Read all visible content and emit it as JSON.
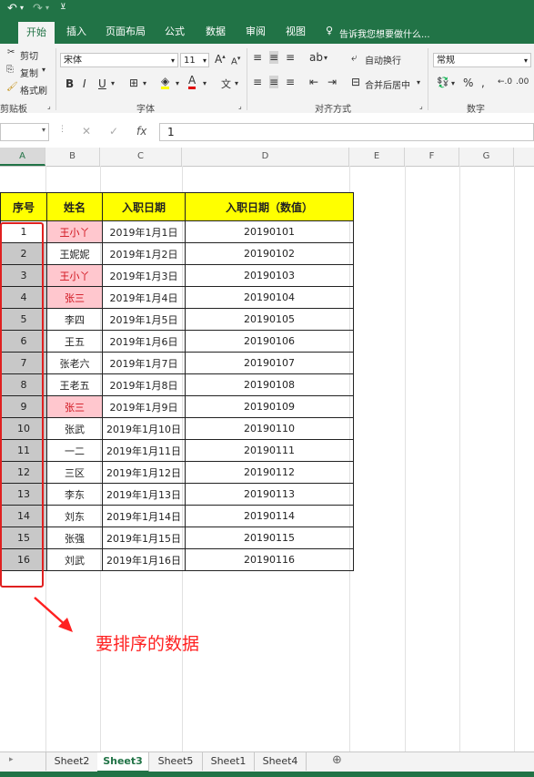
{
  "ribbon": {
    "tabs": [
      {
        "label": "开始",
        "active": true
      },
      {
        "label": "插入",
        "active": false
      },
      {
        "label": "页面布局",
        "active": false
      },
      {
        "label": "公式",
        "active": false
      },
      {
        "label": "数据",
        "active": false
      },
      {
        "label": "审阅",
        "active": false
      },
      {
        "label": "视图",
        "active": false
      }
    ],
    "tell_me": "告诉我您想要做什么...",
    "clipboard": {
      "cut": "剪切",
      "copy": "复制",
      "format_painter": "格式刷",
      "group": "剪贴板"
    },
    "font": {
      "name": "宋体",
      "size": "11",
      "group": "字体"
    },
    "alignment": {
      "wrap": "自动换行",
      "merge": "合并后居中",
      "group": "对齐方式"
    },
    "number": {
      "format": "常规",
      "group": "数字"
    }
  },
  "formula_bar": {
    "name_box": "",
    "formula": "1",
    "fx": "fx"
  },
  "columns": [
    "A",
    "B",
    "C",
    "D",
    "E",
    "F",
    "G"
  ],
  "table": {
    "headers": [
      "序号",
      "姓名",
      "入职日期",
      "入职日期（数值）"
    ],
    "rows": [
      {
        "seq": "1",
        "name": "王小丫",
        "date": "2019年1月1日",
        "num": "20190101",
        "dup": true
      },
      {
        "seq": "2",
        "name": "王妮妮",
        "date": "2019年1月2日",
        "num": "20190102",
        "dup": false
      },
      {
        "seq": "3",
        "name": "王小丫",
        "date": "2019年1月3日",
        "num": "20190103",
        "dup": true
      },
      {
        "seq": "4",
        "name": "张三",
        "date": "2019年1月4日",
        "num": "20190104",
        "dup": true
      },
      {
        "seq": "5",
        "name": "李四",
        "date": "2019年1月5日",
        "num": "20190105",
        "dup": false
      },
      {
        "seq": "6",
        "name": "王五",
        "date": "2019年1月6日",
        "num": "20190106",
        "dup": false
      },
      {
        "seq": "7",
        "name": "张老六",
        "date": "2019年1月7日",
        "num": "20190107",
        "dup": false
      },
      {
        "seq": "8",
        "name": "王老五",
        "date": "2019年1月8日",
        "num": "20190108",
        "dup": false
      },
      {
        "seq": "9",
        "name": "张三",
        "date": "2019年1月9日",
        "num": "20190109",
        "dup": true
      },
      {
        "seq": "10",
        "name": "张武",
        "date": "2019年1月10日",
        "num": "20190110",
        "dup": false
      },
      {
        "seq": "11",
        "name": "一二",
        "date": "2019年1月11日",
        "num": "20190111",
        "dup": false
      },
      {
        "seq": "12",
        "name": "三区",
        "date": "2019年1月12日",
        "num": "20190112",
        "dup": false
      },
      {
        "seq": "13",
        "name": "李东",
        "date": "2019年1月13日",
        "num": "20190113",
        "dup": false
      },
      {
        "seq": "14",
        "name": "刘东",
        "date": "2019年1月14日",
        "num": "20190114",
        "dup": false
      },
      {
        "seq": "15",
        "name": "张强",
        "date": "2019年1月15日",
        "num": "20190115",
        "dup": false
      },
      {
        "seq": "16",
        "name": "刘武",
        "date": "2019年1月16日",
        "num": "20190116",
        "dup": false
      }
    ]
  },
  "annotation": "要排序的数据",
  "sheets": [
    {
      "label": "Sheet2",
      "active": false
    },
    {
      "label": "Sheet3",
      "active": true
    },
    {
      "label": "Sheet5",
      "active": false
    },
    {
      "label": "Sheet1",
      "active": false
    },
    {
      "label": "Sheet4",
      "active": false
    }
  ],
  "colors": {
    "accent": "#217346",
    "header_fill": "#ffff00",
    "dup_fill": "#ffc7ce",
    "dup_text": "#d0121c",
    "seq_fill": "#c8c8c8",
    "annotation": "#ff2020"
  }
}
